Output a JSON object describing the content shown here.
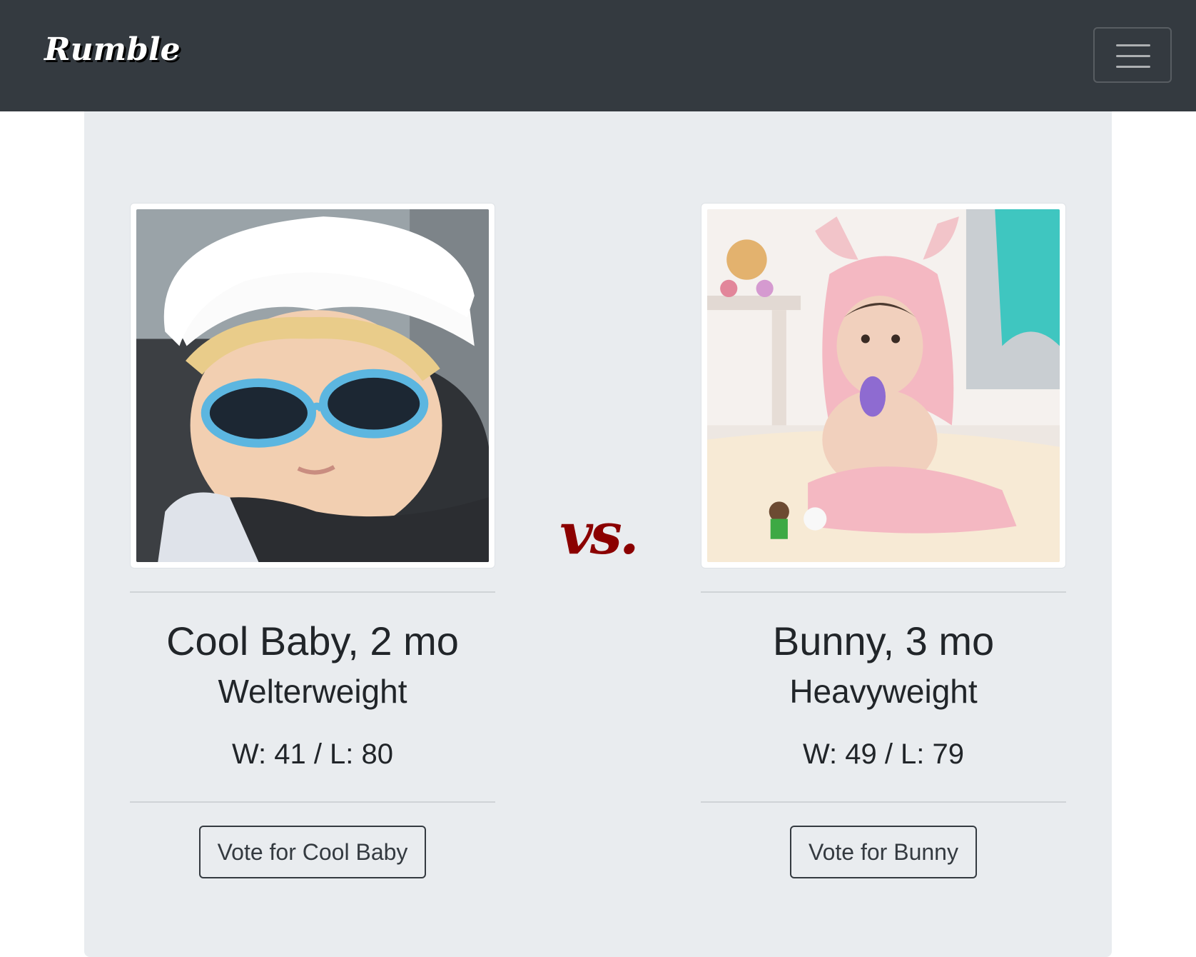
{
  "navbar": {
    "brand": "Rumble",
    "menu_icon": "hamburger-menu-icon",
    "background_color": "#343a40"
  },
  "matchup": {
    "vs_label": "vs.",
    "vs_color": "#8b0000",
    "left": {
      "name": "Cool Baby, 2 mo",
      "weight_class": "Welterweight",
      "record": "W: 41 / L: 80",
      "vote_label": "Vote for Cool Baby"
    },
    "right": {
      "name": "Bunny, 3 mo",
      "weight_class": "Heavyweight",
      "record": "W: 49 / L: 79",
      "vote_label": "Vote for Bunny"
    }
  }
}
